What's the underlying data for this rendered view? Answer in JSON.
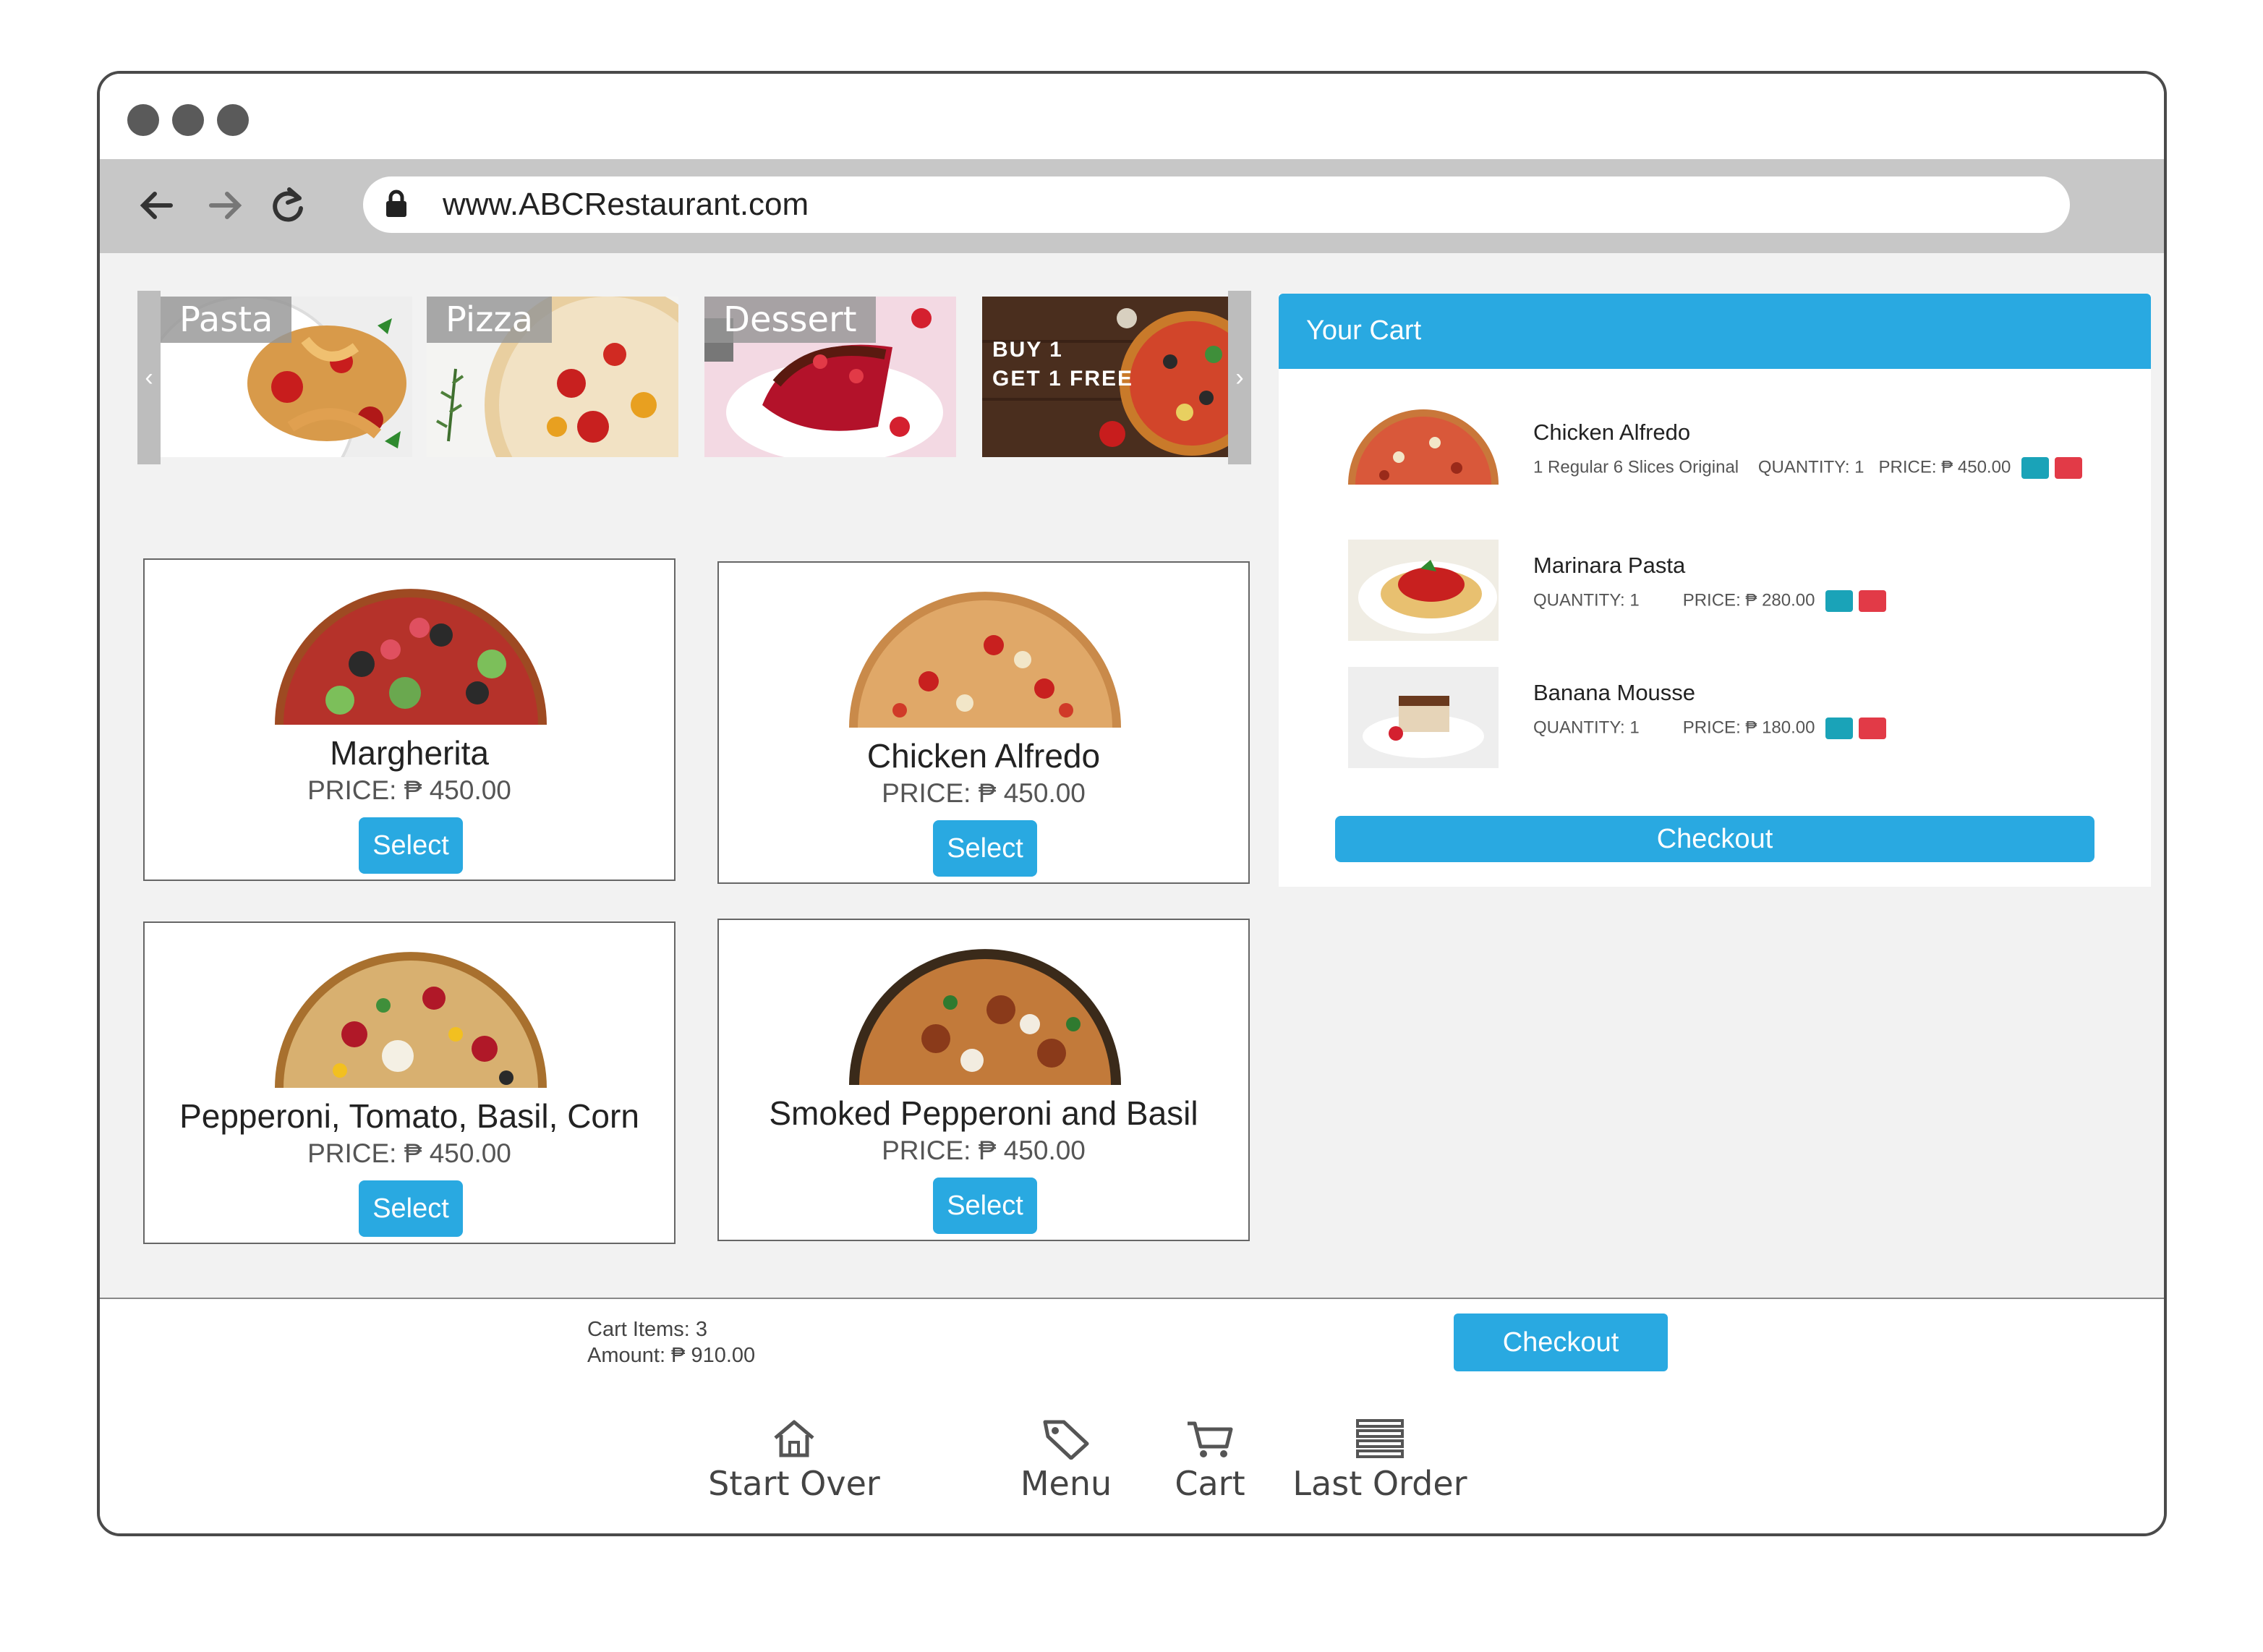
{
  "browser": {
    "url": "www.ABCRestaurant.com"
  },
  "categories": [
    {
      "label": "Pasta"
    },
    {
      "label": "Pizza"
    },
    {
      "label": "Dessert"
    }
  ],
  "promo": {
    "line1": "BUY 1",
    "line2": "GET 1 FREE"
  },
  "products": [
    {
      "name": "Margherita",
      "price": "PRICE: ₱ 450.00",
      "select_label": "Select"
    },
    {
      "name": "Chicken Alfredo",
      "price": "PRICE: ₱ 450.00",
      "select_label": "Select"
    },
    {
      "name": "Pepperoni, Tomato, Basil, Corn",
      "price": "PRICE: ₱ 450.00",
      "select_label": "Select"
    },
    {
      "name": "Smoked Pepperoni and Basil",
      "price": "PRICE: ₱ 450.00",
      "select_label": "Select"
    }
  ],
  "cart": {
    "title": "Your Cart",
    "items": [
      {
        "name": "Chicken Alfredo",
        "detail": "1 Regular 6 Slices Original",
        "quantity": "QUANTITY: 1",
        "price": "PRICE: ₱ 450.00"
      },
      {
        "name": "Marinara Pasta",
        "quantity": "QUANTITY: 1",
        "price": "PRICE: ₱ 280.00"
      },
      {
        "name": "Banana Mousse",
        "quantity": "QUANTITY: 1",
        "price": "PRICE: ₱ 180.00"
      }
    ],
    "checkout_label": "Checkout"
  },
  "summary": {
    "items_text": "Cart Items: 3",
    "amount_text": "Amount: ₱ 910.00",
    "checkout_label": "Checkout"
  },
  "tabs": [
    {
      "label": "Start Over",
      "icon": "home-icon"
    },
    {
      "label": "Menu",
      "icon": "tag-icon"
    },
    {
      "label": "Cart",
      "icon": "cart-icon"
    },
    {
      "label": "Last Order",
      "icon": "list-icon"
    }
  ],
  "colors": {
    "accent": "#29a9e1",
    "edit": "#1aa3b8",
    "delete": "#e23a47"
  }
}
